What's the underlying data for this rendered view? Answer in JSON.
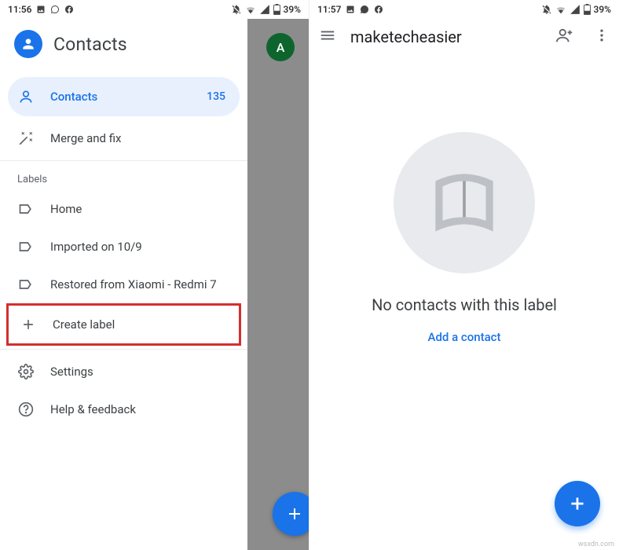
{
  "status": {
    "time_left": "11:56",
    "time_right": "11:57",
    "battery": "39%"
  },
  "drawer": {
    "app_title": "Contacts",
    "contacts_label": "Contacts",
    "contacts_count": "135",
    "merge_label": "Merge and fix",
    "labels_header": "Labels",
    "label_home": "Home",
    "label_imported": "Imported on 10/9",
    "label_restored": "Restored from Xiaomi - Redmi 7",
    "create_label": "Create label",
    "settings_label": "Settings",
    "help_label": "Help & feedback",
    "avatar_initial": "A"
  },
  "right": {
    "title": "maketecheasier",
    "empty_text": "No contacts with this label",
    "add_link": "Add a contact"
  },
  "watermark": "wsxdn.com"
}
